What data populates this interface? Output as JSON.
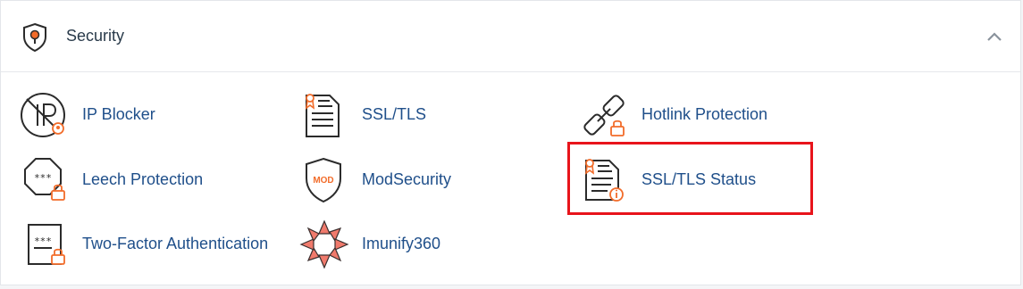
{
  "section": {
    "title": "Security",
    "collapse_icon": "chevron-up-icon",
    "header_icon": "shield-icon"
  },
  "items": {
    "ip_blocker": {
      "label": "IP Blocker",
      "icon": "ip-blocker-icon"
    },
    "ssl_tls": {
      "label": "SSL/TLS",
      "icon": "certificate-document-icon"
    },
    "hotlink_protection": {
      "label": "Hotlink Protection",
      "icon": "broken-link-lock-icon"
    },
    "leech_protection": {
      "label": "Leech Protection",
      "icon": "password-lock-icon"
    },
    "modsecurity": {
      "label": "ModSecurity",
      "icon": "mod-shield-icon",
      "badge": "MOD"
    },
    "ssl_tls_status": {
      "label": "SSL/TLS Status",
      "icon": "certificate-info-icon"
    },
    "two_factor": {
      "label": "Two-Factor Authentication",
      "icon": "two-factor-lock-icon"
    },
    "imunify360": {
      "label": "Imunify360",
      "icon": "imunify360-logo-icon"
    }
  },
  "colors": {
    "link": "#1f4f8a",
    "accent_orange": "#f26c2a",
    "icon_stroke": "#2b2b2b",
    "highlight_border": "#e8141b"
  }
}
